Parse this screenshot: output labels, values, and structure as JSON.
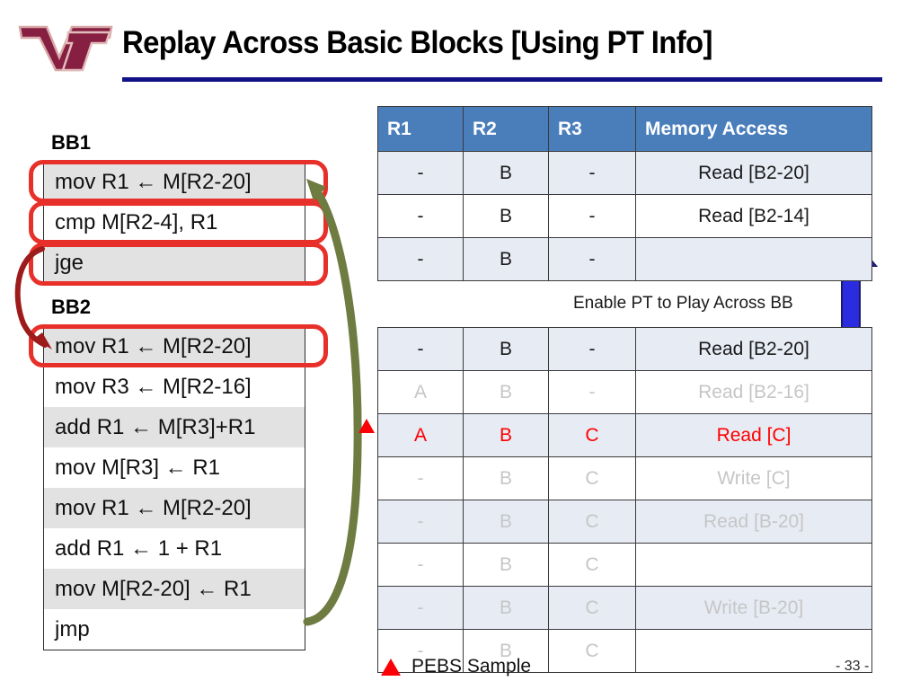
{
  "header": {
    "title": "Replay Across Basic Blocks [Using PT Info]",
    "logo_name": "virginia-tech-vt-logo",
    "rule_color": "#111188"
  },
  "code_panel": {
    "blocks": [
      {
        "label": "BB1",
        "instructions": [
          {
            "text": "mov R1 ← M[R2-20]",
            "shaded": true,
            "highlighted": true
          },
          {
            "text": "cmp M[R2-4], R1",
            "shaded": false,
            "highlighted": true
          },
          {
            "text": "jge",
            "shaded": true,
            "highlighted": true
          }
        ]
      },
      {
        "label": "BB2",
        "instructions": [
          {
            "text": "mov R1 ← M[R2-20]",
            "shaded": true,
            "highlighted": true
          },
          {
            "text": "mov R3 ← M[R2-16]",
            "shaded": false,
            "highlighted": false
          },
          {
            "text": "add R1 ← M[R3]+R1",
            "shaded": true,
            "highlighted": false
          },
          {
            "text": "mov M[R3] ← R1",
            "shaded": false,
            "highlighted": false
          },
          {
            "text": "mov R1 ← M[R2-20]",
            "shaded": true,
            "highlighted": false
          },
          {
            "text": "add R1 ← 1 + R1",
            "shaded": false,
            "highlighted": false
          },
          {
            "text": "mov M[R2-20] ← R1",
            "shaded": true,
            "highlighted": false
          },
          {
            "text": "jmp",
            "shaded": false,
            "highlighted": false
          }
        ]
      }
    ],
    "highlight_color": "#e8302a",
    "branch_arrow_color": "#9e1b1b",
    "replay_arrow_color": "#6e7b41"
  },
  "tables": {
    "columns": [
      "R1",
      "R2",
      "R3",
      "Memory Access"
    ],
    "header_color": "#4a7ebb",
    "top_table": {
      "rows": [
        {
          "r1": "-",
          "r2": "B",
          "r3": "-",
          "mem": "Read [B2-20]",
          "style": "normal",
          "band": "a"
        },
        {
          "r1": "-",
          "r2": "B",
          "r3": "-",
          "mem": "Read [B2-14]",
          "style": "normal",
          "band": "b"
        },
        {
          "r1": "-",
          "r2": "B",
          "r3": "-",
          "mem": "",
          "style": "normal",
          "band": "a"
        }
      ]
    },
    "bottom_table": {
      "rows": [
        {
          "r1": "-",
          "r2": "B",
          "r3": "-",
          "mem": "Read [B2-20]",
          "style": "normal",
          "band": "a",
          "marker": false
        },
        {
          "r1": "A",
          "r2": "B",
          "r3": "-",
          "mem": "Read [B2-16]",
          "style": "faded",
          "band": "b",
          "marker": false
        },
        {
          "r1": "A",
          "r2": "B",
          "r3": "C",
          "mem": "Read [C]",
          "style": "red",
          "band": "a",
          "marker": true
        },
        {
          "r1": "-",
          "r2": "B",
          "r3": "C",
          "mem": "Write [C]",
          "style": "faded",
          "band": "b",
          "marker": false
        },
        {
          "r1": "-",
          "r2": "B",
          "r3": "C",
          "mem": "Read [B-20]",
          "style": "faded",
          "band": "a",
          "marker": false
        },
        {
          "r1": "-",
          "r2": "B",
          "r3": "C",
          "mem": "",
          "style": "faded",
          "band": "b",
          "marker": false
        },
        {
          "r1": "-",
          "r2": "B",
          "r3": "C",
          "mem": "Write [B-20]",
          "style": "faded",
          "band": "a",
          "marker": false
        },
        {
          "r1": "-",
          "r2": "B",
          "r3": "C",
          "mem": "",
          "style": "faded",
          "band": "b",
          "marker": false
        }
      ]
    }
  },
  "annotations": {
    "enable_pt_caption": "Enable PT to Play Across BB",
    "blue_arrow_color": "#2b2be0",
    "blue_arrow_name": "enable-pt-up-arrow"
  },
  "legend": {
    "label": "PEBS Sample",
    "marker_color": "#fb0007"
  },
  "footer": {
    "page_number": "- 33 -"
  }
}
